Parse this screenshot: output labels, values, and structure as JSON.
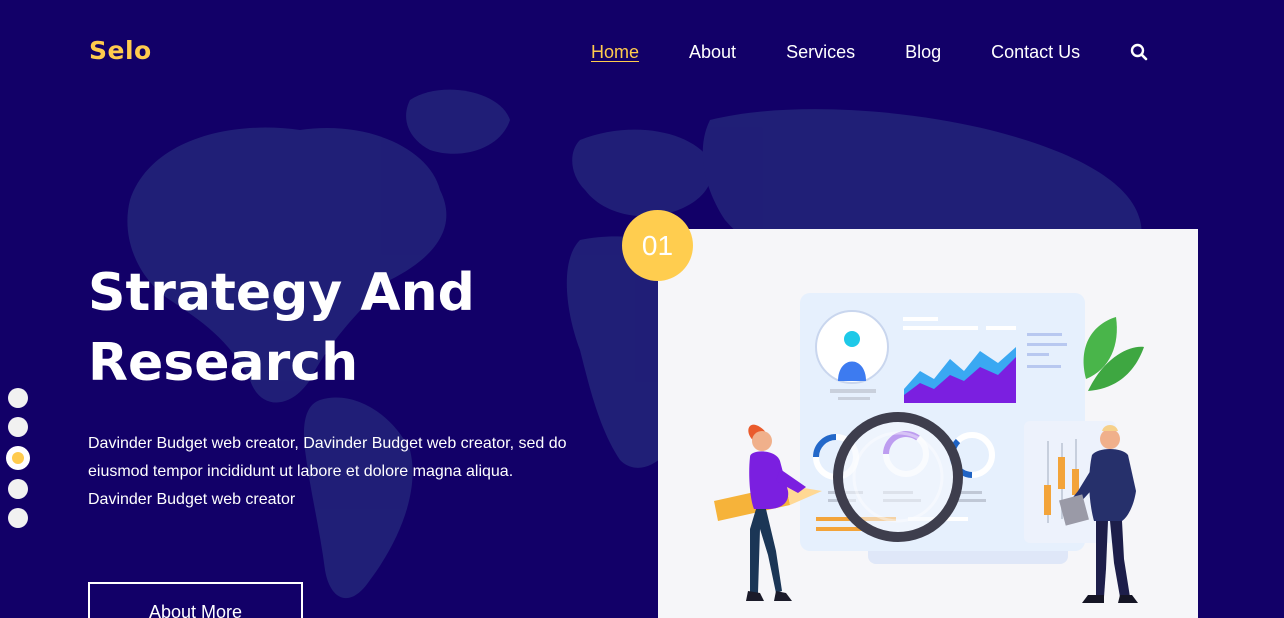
{
  "brand": {
    "logo_text": "Selo"
  },
  "nav": {
    "items": [
      {
        "label": "Home",
        "active": true
      },
      {
        "label": "About",
        "active": false
      },
      {
        "label": "Services",
        "active": false
      },
      {
        "label": "Blog",
        "active": false
      },
      {
        "label": "Contact Us",
        "active": false
      }
    ],
    "search_icon": "search-icon"
  },
  "hero": {
    "title_line1": "Strategy And",
    "title_line2": "Research",
    "description": "Davinder Budget web creator, Davinder Budget web creator, sed do eiusmod tempor incididunt ut labore et dolore magna aliqua. Davinder Budget web creator",
    "cta_label": "About More"
  },
  "slider": {
    "count": 5,
    "active_index": 2
  },
  "feature": {
    "step_number": "01"
  },
  "colors": {
    "background": "#120068",
    "accent": "#ffcb4d",
    "card": "#f6f6f9"
  }
}
